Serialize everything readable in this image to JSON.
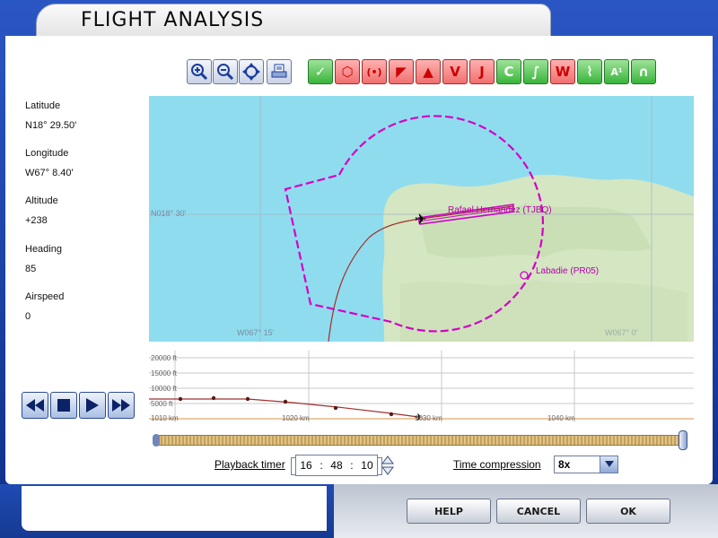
{
  "window": {
    "title": "FLIGHT ANALYSIS"
  },
  "info": {
    "latitude_label": "Latitude",
    "latitude_value": "N18° 29.50'",
    "longitude_label": "Longitude",
    "longitude_value": "W67° 8.40'",
    "altitude_label": "Altitude",
    "altitude_value": "+238",
    "heading_label": "Heading",
    "heading_value": "85",
    "airspeed_label": "Airspeed",
    "airspeed_value": "0"
  },
  "toolbar": {
    "view_tools": [
      "zoom-in-icon",
      "zoom-out-icon",
      "center-icon",
      "print-icon"
    ],
    "filter_tools": [
      {
        "name": "airport-icon",
        "glyph": "✓",
        "style": "green"
      },
      {
        "name": "vor-icon",
        "glyph": "⬡",
        "style": "red"
      },
      {
        "name": "ndb-icon",
        "glyph": "(•)",
        "style": "red"
      },
      {
        "name": "intersection-icon",
        "glyph": "◤",
        "style": "red"
      },
      {
        "name": "obstacle-icon",
        "glyph": "▲",
        "style": "red"
      },
      {
        "name": "victor-airway-icon",
        "glyph": "V",
        "style": "red"
      },
      {
        "name": "jet-airway-icon",
        "glyph": "J",
        "style": "red"
      },
      {
        "name": "airspace-icon",
        "glyph": "C",
        "style": "green"
      },
      {
        "name": "route-icon",
        "glyph": "∫",
        "style": "green"
      },
      {
        "name": "weather-icon",
        "glyph": "W",
        "style": "red"
      },
      {
        "name": "terrain-icon",
        "glyph": "⌇",
        "style": "green"
      },
      {
        "name": "label-icon",
        "glyph": "A¹",
        "style": "green"
      },
      {
        "name": "flight-path-icon",
        "glyph": "∩",
        "style": "green"
      }
    ]
  },
  "map": {
    "lat_label": "N018° 30'",
    "lon_label": "W067° 15'",
    "lon_label_right": "W067° 0'",
    "airport_1": "Rafael Hernandez (TJBQ)",
    "airport_2": "Labadie (PR05)",
    "colors": {
      "water": "#8fdcef",
      "land": "#d4e6c2",
      "airspace": "#d400c8",
      "track": "#a0302c"
    }
  },
  "profile": {
    "altitude_ticks": [
      "20000 ft",
      "15000 ft",
      "10000 ft",
      "5000 ft"
    ],
    "distance_ticks": [
      "1010 km",
      "1020 km",
      "1030 km",
      "1040 km"
    ],
    "track_color": "#a0302c"
  },
  "playback": {
    "buttons": [
      "rewind-icon",
      "stop-icon",
      "play-icon",
      "fast-forward-icon"
    ],
    "timer_label": "Playback timer",
    "timer_hh": "16",
    "timer_mm": "48",
    "timer_ss": "10",
    "position_fraction": 1.0
  },
  "compression": {
    "label": "Time compression",
    "value": "8x"
  },
  "buttons": {
    "help": "HELP",
    "cancel": "CANCEL",
    "ok": "OK"
  }
}
